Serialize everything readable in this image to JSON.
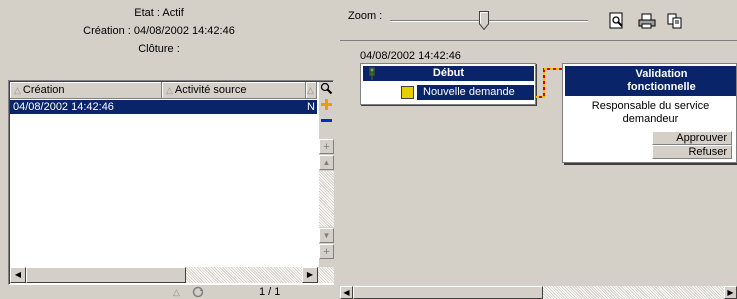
{
  "info": {
    "etat": "Etat : Actif",
    "creation": "Création : 04/08/2002 14:42:46",
    "cloture": "Clôture :"
  },
  "grid": {
    "columns": [
      "Création",
      "Activité source"
    ],
    "rows": [
      {
        "creation": "04/08/2002 14:42:46",
        "suffix": "N"
      }
    ],
    "page": "1 / 1"
  },
  "toolbar": {
    "zoom_label": "Zoom :",
    "zoom_level": 0.5
  },
  "workflow": {
    "timestamp": "04/08/2002 14:42:46",
    "start_node": {
      "title": "Début",
      "activity": "Nouvelle demande"
    },
    "validation_node": {
      "title_line1": "Validation",
      "title_line2": "fonctionnelle",
      "desc_line1": "Responsable du service",
      "desc_line2": "demandeur",
      "approve": "Approuver",
      "refuse": "Refuser"
    }
  },
  "colors": {
    "selection": "#0a246a",
    "connector": "#e00000",
    "connector_alt": "#f0c000"
  }
}
